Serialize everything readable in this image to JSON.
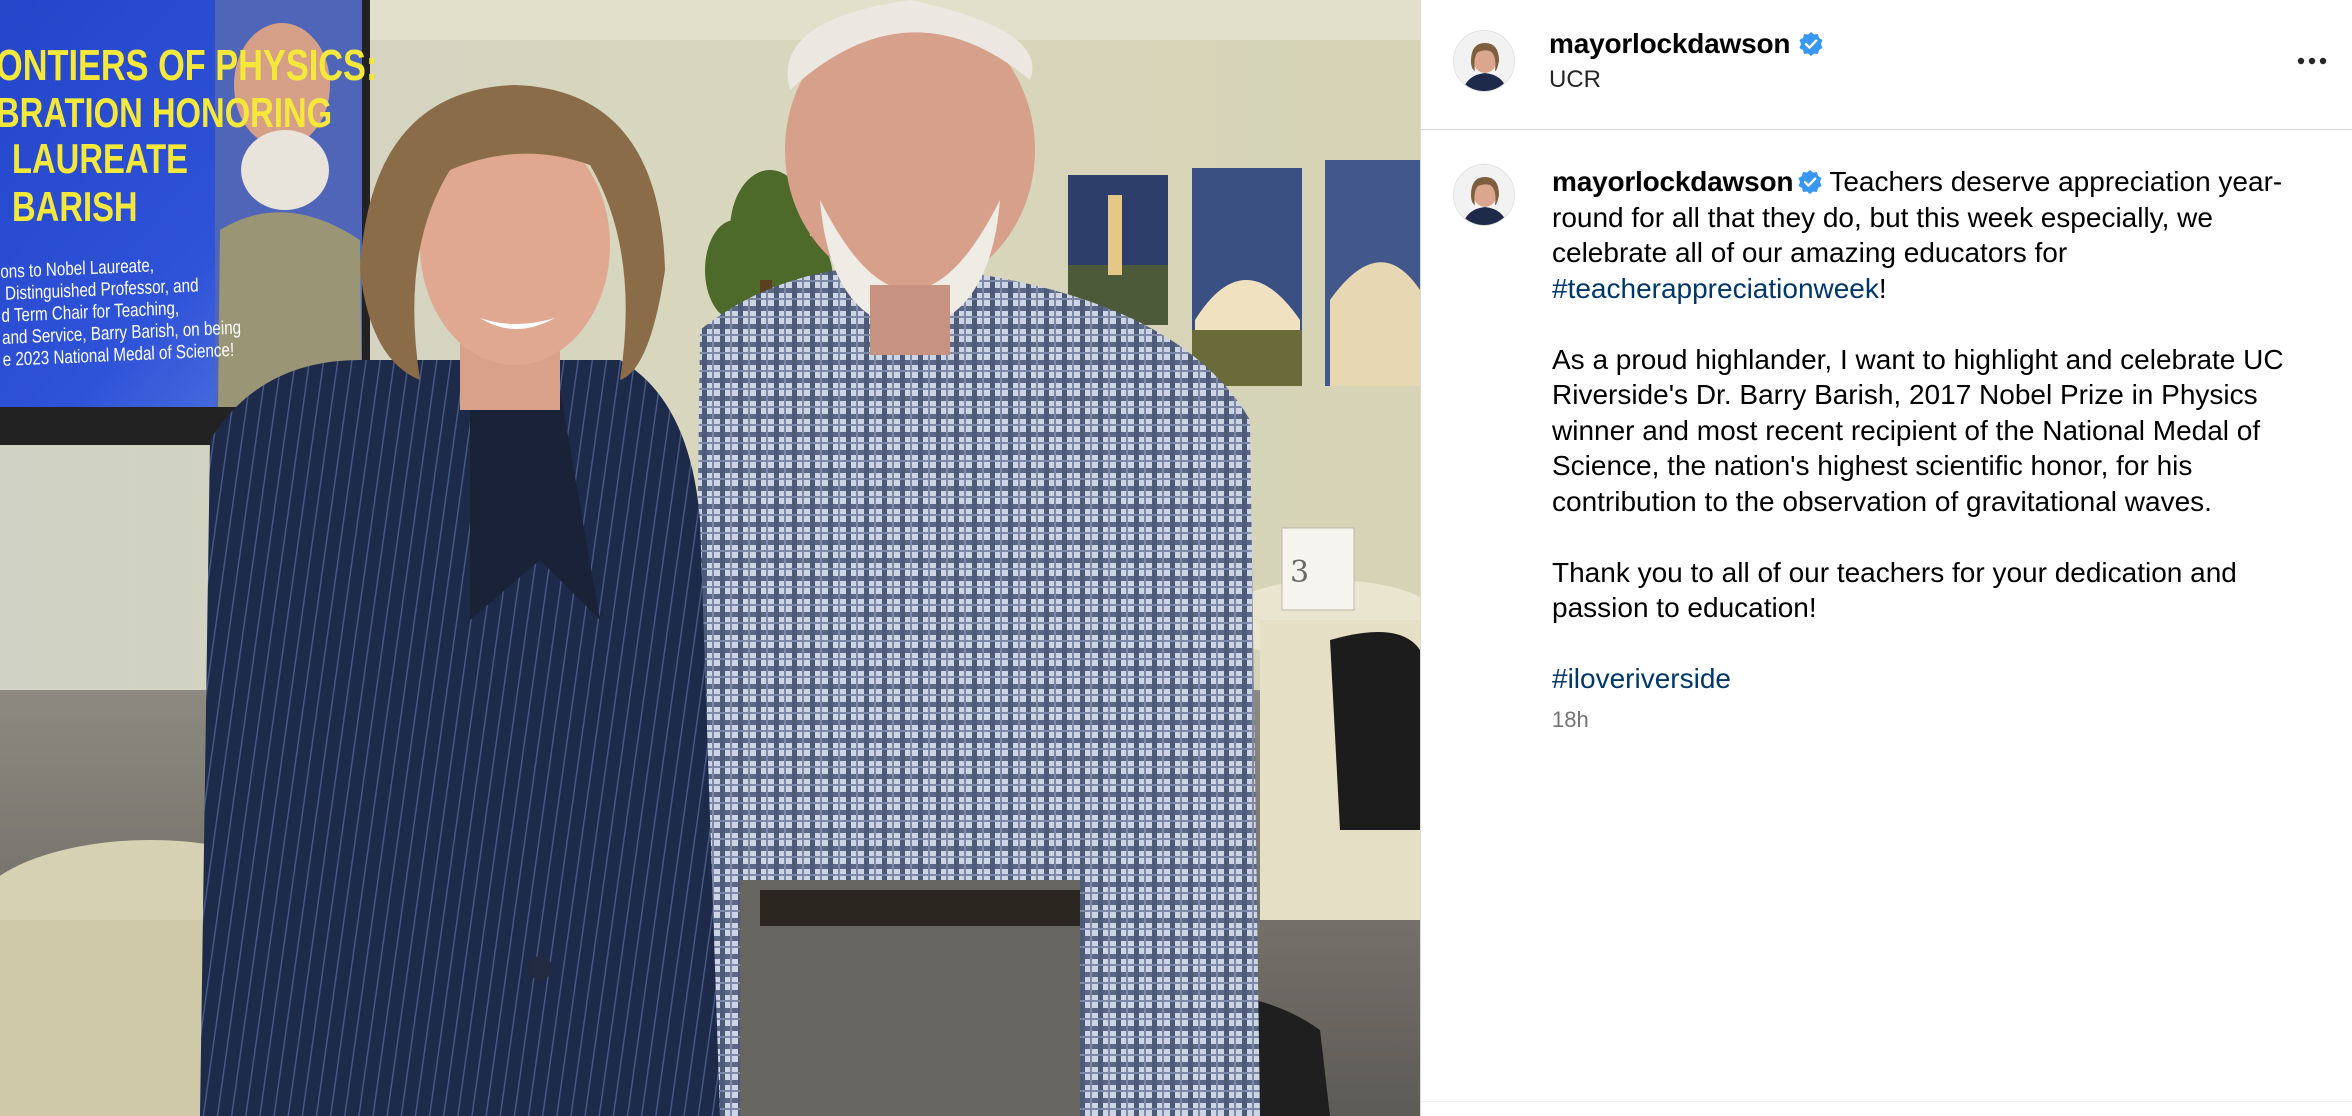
{
  "post": {
    "username": "mayorlockdawson",
    "location": "UCR",
    "verified": true,
    "more_icon": "more-horizontal-icon",
    "timestamp": "18h",
    "caption": {
      "intro": "Teachers deserve appreciation year-round for all that they do, but this week especially, we celebrate all of our amazing educators for ",
      "hashtag1": "#teacherappreciationweek",
      "intro_end": "!",
      "paragraph2": "As a proud highlander, I want to highlight and celebrate UC Riverside's Dr. Barry Barish, 2017 Nobel Prize in Physics winner and most recent recipient of the National Medal of Science, the nation's highest scientific honor, for his contribution to the observation of gravitational waves.",
      "paragraph3": "Thank you to all of our teachers for your dedication and passion to education!",
      "hashtag2": "#iloveriverside"
    }
  },
  "photo": {
    "screen_title_lines": [
      "ONTIERS OF PHYSICS:",
      "BRATION HONORING",
      "LAUREATE",
      "BARISH"
    ],
    "screen_subtitle": "ons to Nobel Laureate,\n Distinguished Professor, and\nd Term Chair for Teaching,\nand Service, Barry Barish, on being\ne 2023 National Medal of Science!",
    "table_card_number": "3"
  },
  "colors": {
    "hashtag": "#00376b",
    "verified_badge": "#3897f0",
    "timestamp": "#737373",
    "screen_title": "#f4e93a"
  }
}
